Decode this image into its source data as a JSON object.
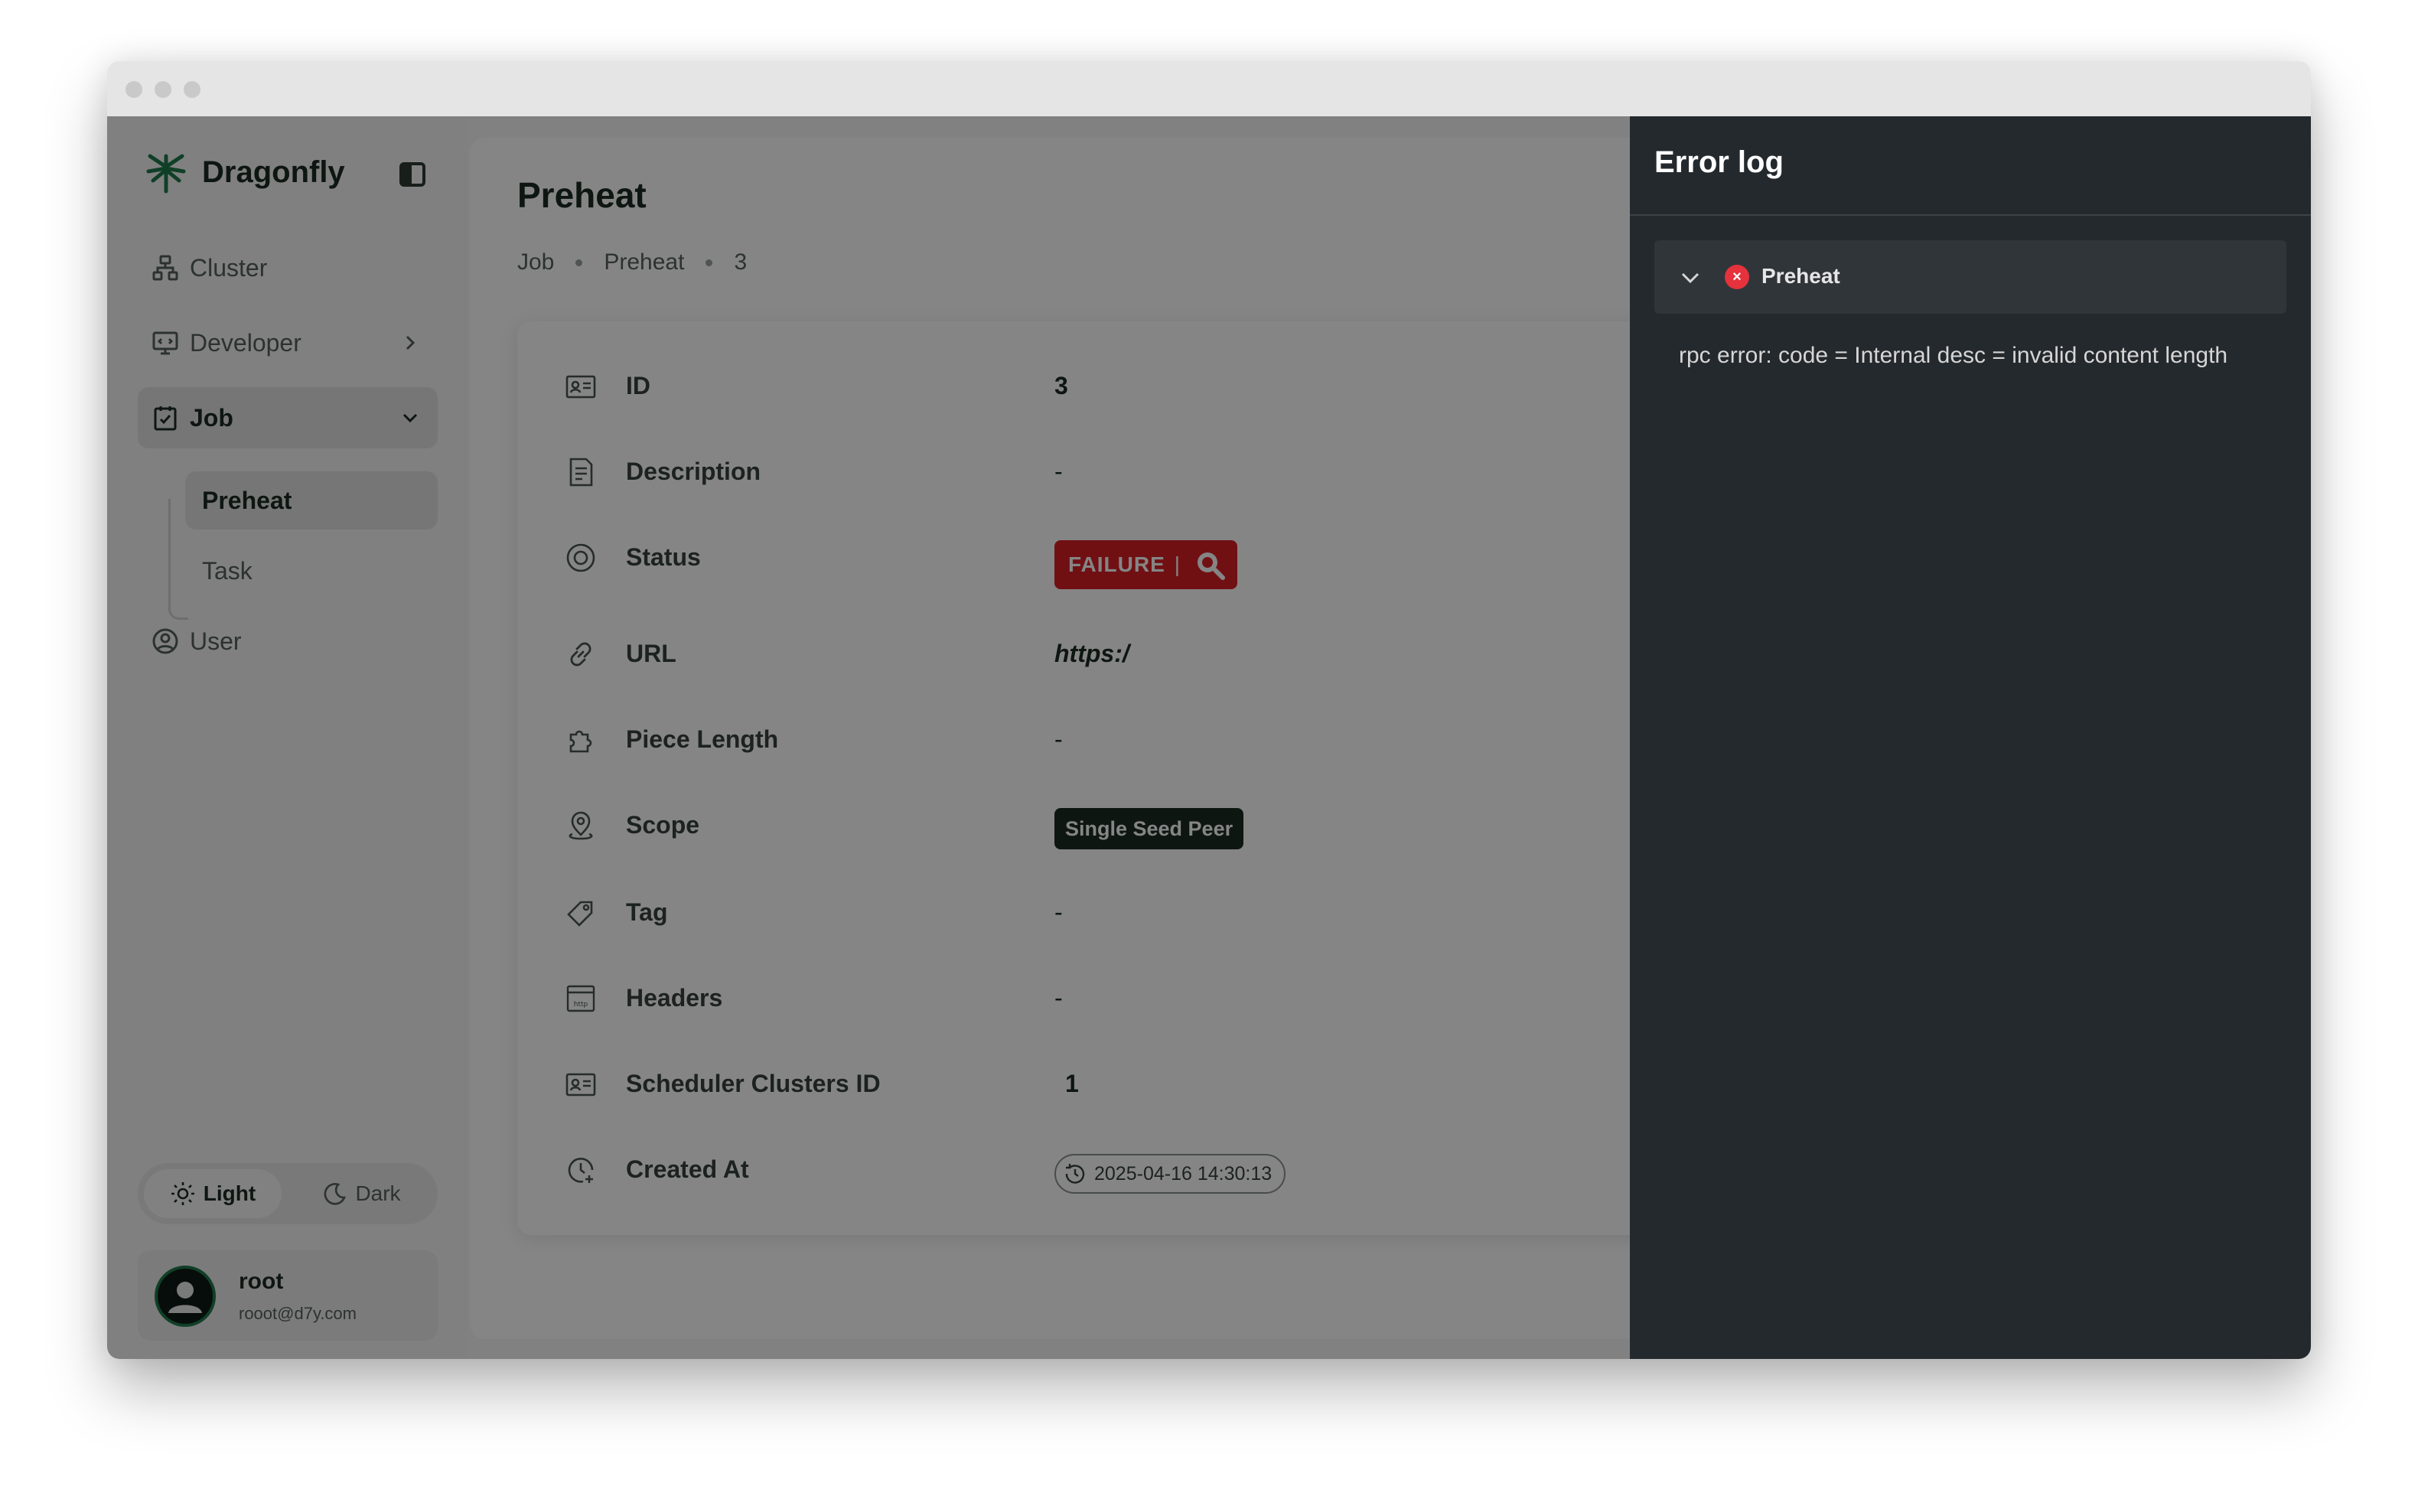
{
  "sidebar": {
    "brand": "Dragonfly",
    "nav": [
      {
        "label": "Cluster",
        "icon": "cluster-icon"
      },
      {
        "label": "Developer",
        "icon": "developer-icon"
      },
      {
        "label": "Job",
        "icon": "job-icon"
      },
      {
        "label": "User",
        "icon": "user-icon"
      }
    ],
    "job_sub": [
      "Preheat",
      "Task"
    ],
    "theme": {
      "light": "Light",
      "dark": "Dark",
      "selected": "Light"
    },
    "user": {
      "name": "root",
      "email": "rooot@d7y.com"
    }
  },
  "main": {
    "title": "Preheat",
    "breadcrumb": [
      "Job",
      "Preheat",
      "3"
    ],
    "details": {
      "id": {
        "label": "ID",
        "value": "3"
      },
      "description": {
        "label": "Description",
        "value": "-"
      },
      "status": {
        "label": "Status",
        "value": "FAILURE",
        "separator": "|"
      },
      "url": {
        "label": "URL",
        "value": "https:/"
      },
      "piece_length": {
        "label": "Piece Length",
        "value": "-"
      },
      "scope": {
        "label": "Scope",
        "value": "Single Seed Peer"
      },
      "tag": {
        "label": "Tag",
        "value": "-"
      },
      "headers": {
        "label": "Headers",
        "value": "-"
      },
      "scheduler_clusters_id": {
        "label": "Scheduler Clusters ID",
        "value": "1"
      },
      "created_at": {
        "label": "Created At",
        "value": "2025-04-16 14:30:13"
      }
    }
  },
  "drawer": {
    "title": "Error log",
    "item_title": "Preheat",
    "message": "rpc error: code = Internal desc = invalid content length"
  },
  "colors": {
    "brand_green": "#1f7a4c",
    "failure_red": "#d81f26",
    "drawer_bg": "#24292e"
  }
}
